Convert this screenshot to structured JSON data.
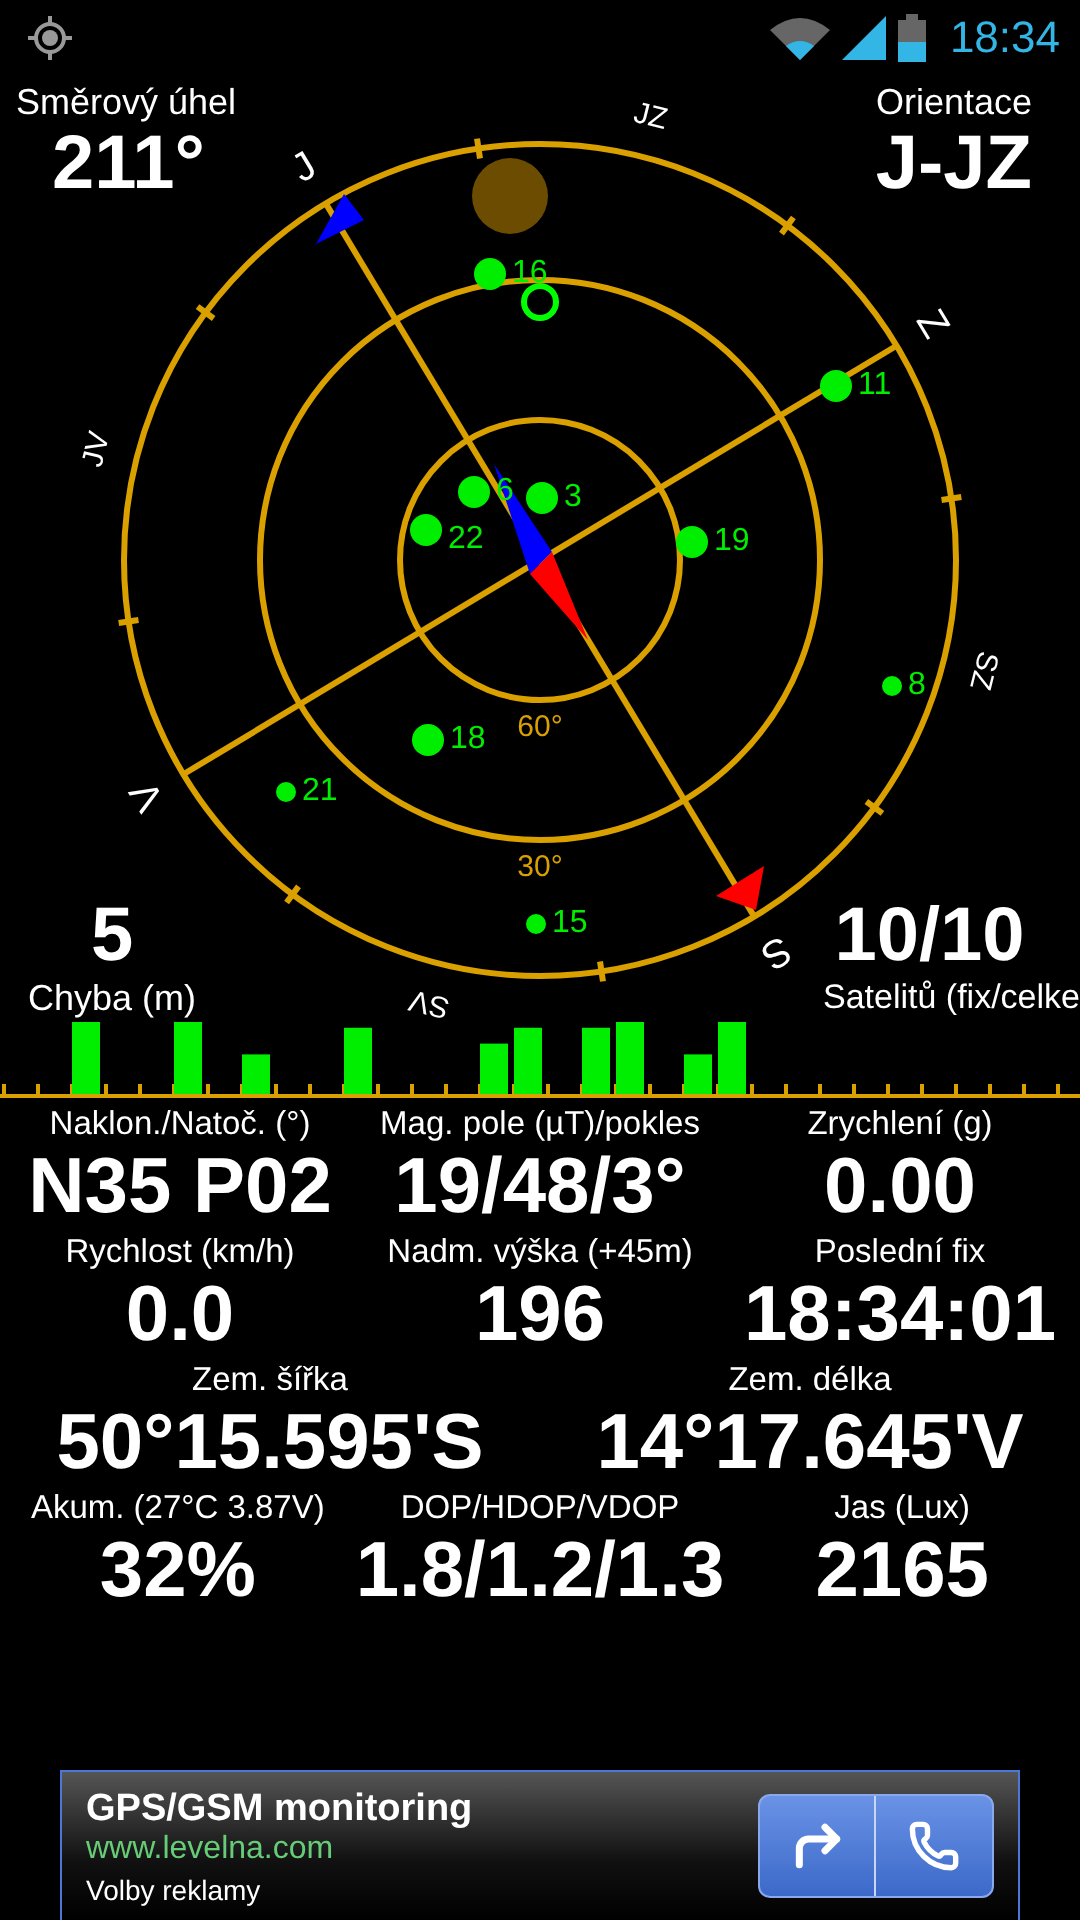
{
  "status_bar": {
    "time": "18:34"
  },
  "heading": {
    "label": "Směrový úhel",
    "value": "211°"
  },
  "orientation": {
    "label": "Orientace",
    "value": "J-JZ"
  },
  "error": {
    "label": "Chyba (m)",
    "value": "5"
  },
  "satellite_count": {
    "label": "Satelitů (fix/celke",
    "value": "10/10"
  },
  "sky_plot": {
    "direction_labels": [
      "J",
      "JZ",
      "Z",
      "SZ",
      "S",
      "SV",
      "V",
      "JV"
    ],
    "elevation_labels": [
      "60°",
      "30°"
    ],
    "satellites": [
      {
        "label": "16"
      },
      {
        "label": "11"
      },
      {
        "label": "6"
      },
      {
        "label": "3"
      },
      {
        "label": "22"
      },
      {
        "label": "19"
      },
      {
        "label": "8"
      },
      {
        "label": "18"
      },
      {
        "label": "21"
      },
      {
        "label": "15"
      }
    ]
  },
  "readout_rows": [
    [
      {
        "label": "Naklon./Natoč. (°)",
        "value": "N35 P02"
      },
      {
        "label": "Mag. pole (µT)/pokles",
        "value": "19/48/3°"
      },
      {
        "label": "Zrychlení (g)",
        "value": "0.00"
      }
    ],
    [
      {
        "label": "Rychlost (km/h)",
        "value": "0.0"
      },
      {
        "label": "Nadm. výška (+45m)",
        "value": "196"
      },
      {
        "label": "Poslední fix",
        "value": "18:34:01"
      }
    ],
    [
      {
        "label": "Zem. šířka",
        "value": "50°15.595'S"
      },
      {
        "label": "Zem. délka",
        "value": "14°17.645'V"
      }
    ],
    [
      {
        "label": "Akum. (27°C 3.87V)",
        "value": "32%"
      },
      {
        "label": "DOP/HDOP/VDOP",
        "value": "1.8/1.2/1.3"
      },
      {
        "label": "Jas (Lux)",
        "value": "2165"
      }
    ]
  ],
  "ad": {
    "title": "GPS/GSM monitoring",
    "url": "www.levelna.com",
    "options": "Volby reklamy"
  }
}
